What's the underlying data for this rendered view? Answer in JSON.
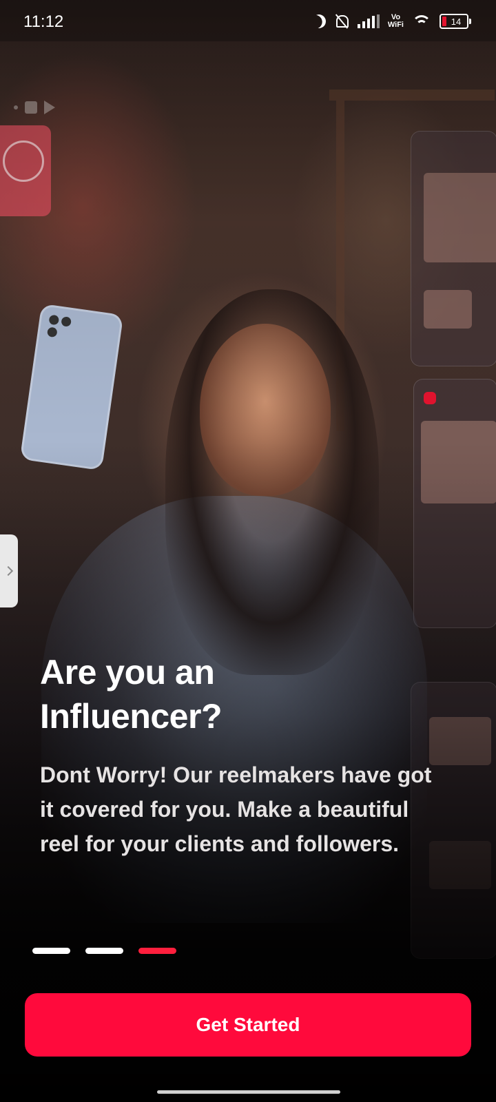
{
  "status_bar": {
    "time": "11:12",
    "vowifi_top": "Vo",
    "vowifi_bottom": "WiFi",
    "battery_level": "14"
  },
  "onboarding": {
    "headline": "Are you an\nInfluencer?",
    "description": "Dont Worry! Our reelmakers have got it covered for you. Make a beautiful reel for your clients and followers.",
    "pager": {
      "total": 3,
      "active_index": 2
    }
  },
  "cta": {
    "label": "Get Started"
  },
  "colors": {
    "accent": "#ff0a3c",
    "pager_active": "#ff1f3d",
    "pager_inactive": "#ffffff"
  },
  "icons": [
    "moon-icon",
    "mute-icon",
    "signal-icon",
    "wifi-icon",
    "battery-icon",
    "chevron-right-icon"
  ]
}
